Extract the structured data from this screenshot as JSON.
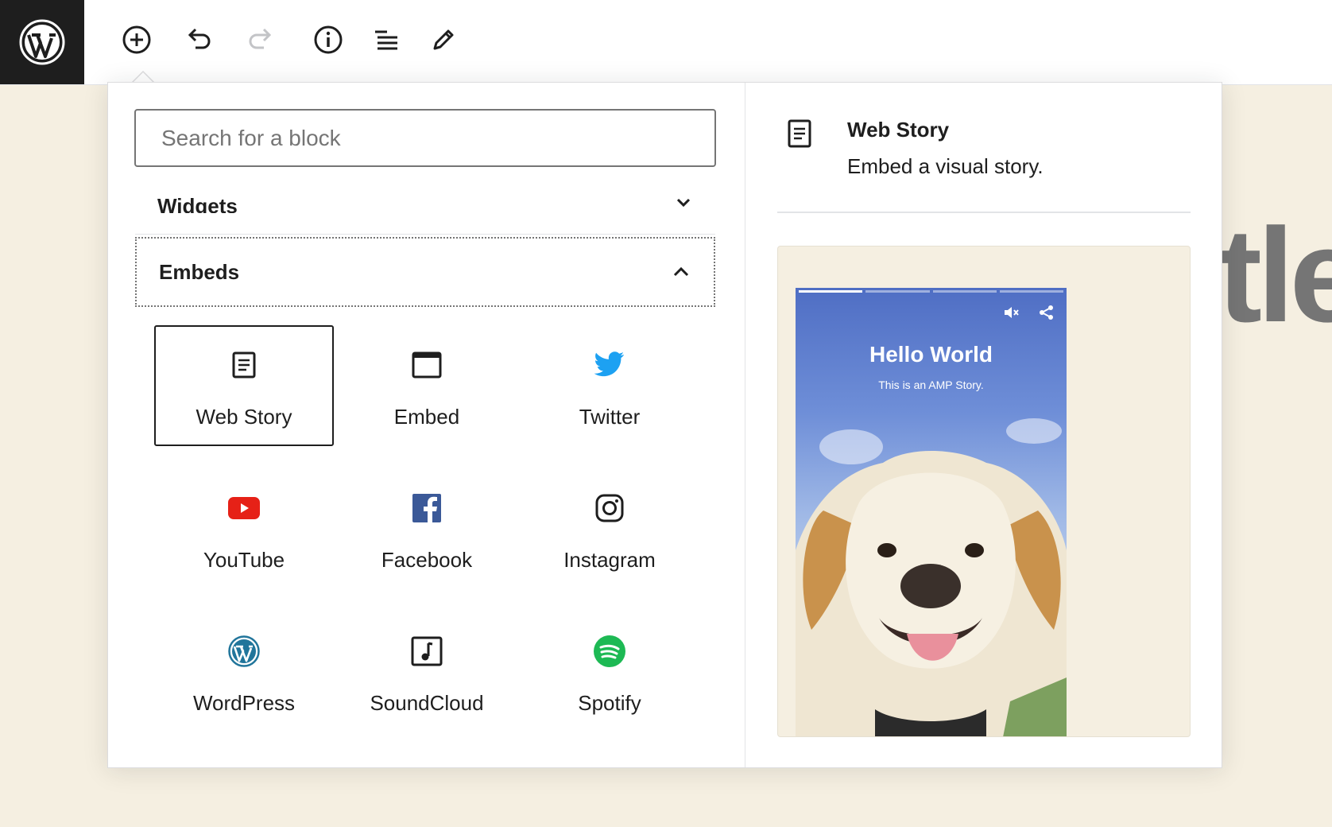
{
  "toolbar": {
    "logo": "wordpress-logo",
    "buttons": [
      "add-block",
      "undo",
      "redo",
      "info",
      "list-view",
      "tools"
    ]
  },
  "background": {
    "title_fragment": "tle"
  },
  "search": {
    "placeholder": "Search for a block"
  },
  "sections": {
    "widgets": "Widgets",
    "embeds": "Embeds"
  },
  "blocks": [
    {
      "label": "Web Story",
      "icon": "document-icon"
    },
    {
      "label": "Embed",
      "icon": "embed-window-icon"
    },
    {
      "label": "Twitter",
      "icon": "twitter-icon"
    },
    {
      "label": "YouTube",
      "icon": "youtube-icon"
    },
    {
      "label": "Facebook",
      "icon": "facebook-icon"
    },
    {
      "label": "Instagram",
      "icon": "instagram-icon"
    },
    {
      "label": "WordPress",
      "icon": "wordpress-icon"
    },
    {
      "label": "SoundCloud",
      "icon": "music-icon"
    },
    {
      "label": "Spotify",
      "icon": "spotify-icon"
    }
  ],
  "preview": {
    "title": "Web Story",
    "description": "Embed a visual story.",
    "story_title": "Hello World",
    "story_subtitle": "This is an AMP Story."
  },
  "colors": {
    "twitter": "#1da1f2",
    "youtube": "#e62117",
    "facebook": "#3b5998",
    "wordpress": "#21759b",
    "spotify": "#1db954",
    "dark": "#1e1e1e"
  }
}
